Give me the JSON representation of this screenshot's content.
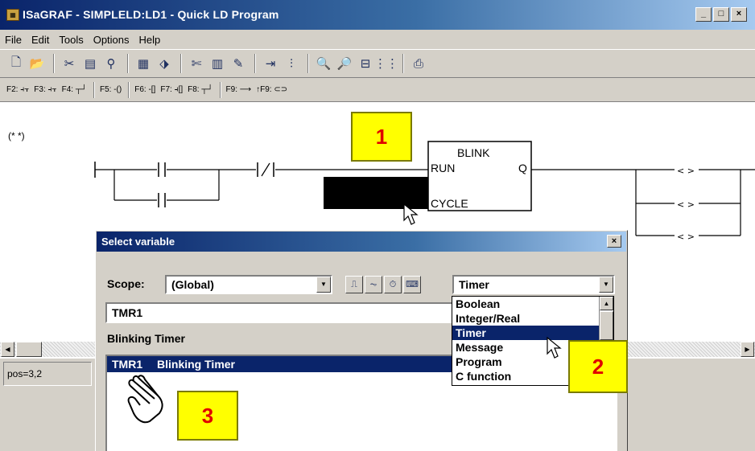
{
  "window": {
    "title": "ISaGRAF - SIMPLELD:LD1 - Quick LD Program",
    "minimize": "_",
    "maximize": "□",
    "close": "×"
  },
  "menu": [
    "File",
    "Edit",
    "Tools",
    "Options",
    "Help"
  ],
  "toolbar": {
    "icons": [
      "new-icon",
      "open-icon",
      "cut-icon",
      "copy-icon",
      "paste-icon",
      "fb-icon",
      "connect-icon",
      "scissors-icon",
      "dictionary-icon",
      "brush-icon",
      "insert-icon",
      "variable-icon",
      "zoom-out-icon",
      "zoom-in-icon",
      "fit-icon",
      "grid-icon",
      "print-icon"
    ]
  },
  "fkeys": {
    "f2": "F2: ⫞⫟",
    "f3": "F3: ⫞⫟",
    "f4": "F4: ┬┘",
    "f5": "F5: -()",
    "f6": "F6: -[]",
    "f7": "F7: ⫞[]",
    "f8": "F8: ┬┘",
    "f9": "F9: ⟶",
    "sf9": "↑F9: ⊂⊃"
  },
  "ladder": {
    "comment": "(* *)",
    "fb_name": "BLINK",
    "fb_in1": "RUN",
    "fb_in2": "CYCLE",
    "fb_out": "Q"
  },
  "callouts": [
    "1",
    "2",
    "3"
  ],
  "status": {
    "position": "pos=3,2"
  },
  "dialog": {
    "title": "Select variable",
    "close": "×",
    "scope_label": "Scope:",
    "scope_value": "(Global)",
    "type_value": "Timer",
    "name_value": "TMR1",
    "comment_value": "Blinking Timer",
    "list": [
      {
        "name": "TMR1",
        "comment": "Blinking Timer"
      }
    ],
    "type_options": [
      "Boolean",
      "Integer/Real",
      "Timer",
      "Message",
      "Program",
      "C function"
    ],
    "selected_type_index": 2
  },
  "colors": {
    "title_active": "#0a246a",
    "callout_fill": "#ffff00",
    "callout_text": "#e00000",
    "face": "#d4d0c8"
  }
}
